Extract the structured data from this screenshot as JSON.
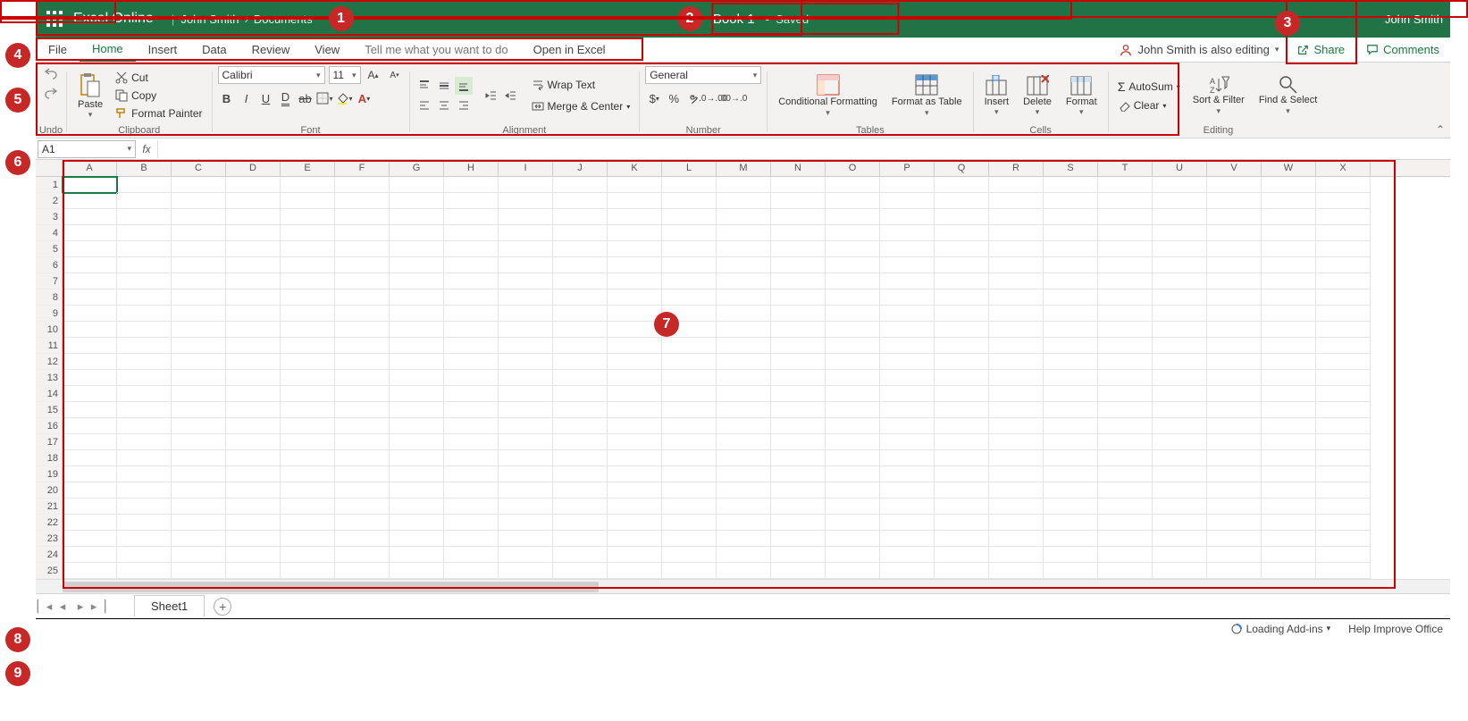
{
  "titlebar": {
    "app_name": "Excel Online",
    "crumb_user": "John Smith",
    "crumb_folder": "Documents",
    "doc_name": "Book 1",
    "saved_status": "Saved",
    "user_name": "John Smith"
  },
  "tabs": {
    "items": [
      "File",
      "Home",
      "Insert",
      "Data",
      "Review",
      "View"
    ],
    "active_index": 1,
    "tell_me": "Tell me what you want to do",
    "open_in_excel": "Open in Excel",
    "presence_text": "John Smith is also editing",
    "share_label": "Share",
    "comments_label": "Comments"
  },
  "ribbon": {
    "undo": {
      "label": "Undo"
    },
    "clipboard": {
      "paste": "Paste",
      "cut": "Cut",
      "copy": "Copy",
      "format_painter": "Format Painter",
      "group_label": "Clipboard"
    },
    "font": {
      "name": "Calibri",
      "size": "11",
      "group_label": "Font"
    },
    "alignment": {
      "wrap": "Wrap Text",
      "merge": "Merge & Center",
      "group_label": "Alignment"
    },
    "number": {
      "format": "General",
      "group_label": "Number"
    },
    "tables": {
      "cond_format": "Conditional Formatting",
      "format_table": "Format as Table",
      "group_label": "Tables"
    },
    "cells": {
      "insert": "Insert",
      "delete": "Delete",
      "format": "Format",
      "group_label": "Cells"
    },
    "editing": {
      "autosum": "AutoSum",
      "clear": "Clear",
      "sort": "Sort & Filter",
      "find": "Find & Select",
      "group_label": "Editing"
    }
  },
  "formula_bar": {
    "cell_ref": "A1",
    "formula": ""
  },
  "grid": {
    "columns": [
      "A",
      "B",
      "C",
      "D",
      "E",
      "F",
      "G",
      "H",
      "I",
      "J",
      "K",
      "L",
      "M",
      "N",
      "O",
      "P",
      "Q",
      "R",
      "S",
      "T",
      "U",
      "V",
      "W",
      "X"
    ],
    "row_count": 25,
    "selected_cell": "A1"
  },
  "sheet_tabs": {
    "active": "Sheet1"
  },
  "statusbar": {
    "addins": "Loading Add-ins",
    "help": "Help Improve Office"
  },
  "callouts": [
    "1",
    "2",
    "3",
    "4",
    "5",
    "6",
    "7",
    "8",
    "9"
  ]
}
